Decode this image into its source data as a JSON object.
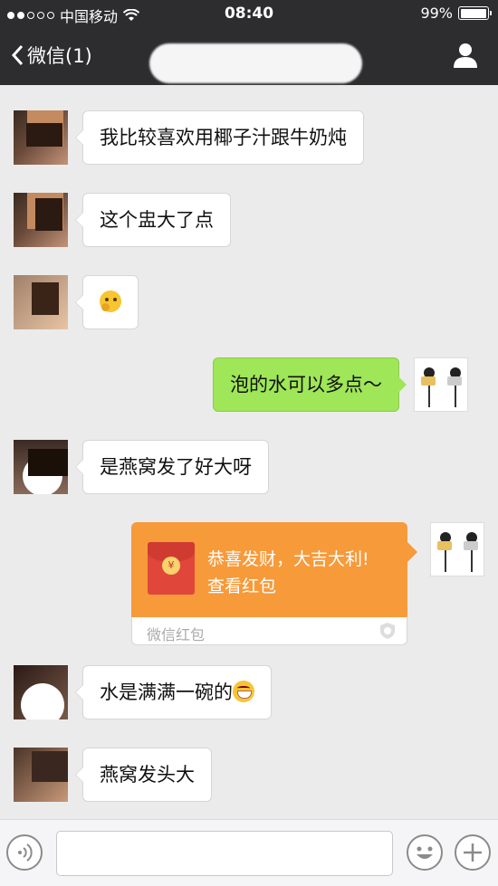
{
  "status": {
    "carrier": "中国移动",
    "time": "08:40",
    "battery": "99%",
    "battery_level": 0.99
  },
  "nav": {
    "back_label": "微信(1)"
  },
  "messages": [
    {
      "side": "left",
      "text": "我比较喜欢用椰子汁跟牛奶炖"
    },
    {
      "side": "left",
      "text": "这个盅大了点"
    },
    {
      "side": "left",
      "text": "",
      "emoji": "thinking-emoji"
    },
    {
      "side": "right",
      "text": "泡的水可以多点～"
    },
    {
      "side": "left",
      "text": "是燕窝发了好大呀"
    },
    {
      "side": "right",
      "type": "red-packet",
      "line1": "恭喜发财，大吉大利!",
      "line2": "查看红包",
      "footer": "微信红包"
    },
    {
      "side": "left",
      "text": "水是满满一碗的",
      "emoji": "grin-emoji"
    },
    {
      "side": "left",
      "text": "燕窝发头大"
    }
  ],
  "colors": {
    "nav_bg": "#2d2d30",
    "chat_bg": "#ebebeb",
    "my_bubble": "#9fe658",
    "red_packet": "#f79a3a"
  }
}
